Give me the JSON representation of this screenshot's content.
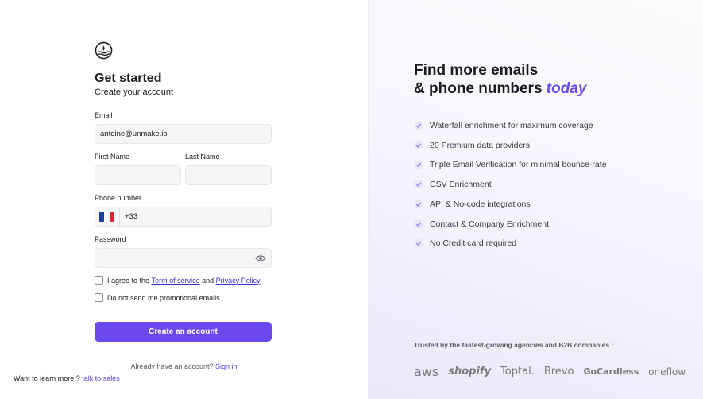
{
  "signup": {
    "title": "Get started",
    "subtitle": "Create your account",
    "email_label": "Email",
    "email_value": "antoine@unmake.io",
    "first_name_label": "First Name",
    "last_name_label": "Last Name",
    "phone_label": "Phone number",
    "phone_prefix": "+33",
    "password_label": "Password",
    "agree_text": "I agree to the",
    "terms_link": "Term of service",
    "and_text": "and",
    "privacy_link": "Privacy Policy",
    "no_promo_text": "Do not send me promotional emails",
    "create_button": "Create an account",
    "have_account": "Already have an account?",
    "sign_in_link": "Sign in",
    "learn_more": "Want to learn more ?",
    "talk_to_sales": "talk to sales"
  },
  "promo": {
    "title_line1": "Find more emails",
    "title_line2": "& phone numbers",
    "title_emphasis": "today",
    "features": [
      "Waterfall enrichment for maximum coverage",
      "20 Premium data providers",
      "Triple Email Verification for minimal bounce-rate",
      "CSV Enrichment",
      "API & No-code integrations",
      "Contact & Company Enrichment",
      "No Credit card required"
    ],
    "trusted_text": "Trusted by the fastest-growing agencies and B2B companies :",
    "brands": [
      "aws",
      "shopify",
      "Toptal.",
      "Brevo",
      "GoCardless",
      "oneflow"
    ]
  },
  "colors": {
    "accent": "#6a48ec",
    "link": "#3a2ccf",
    "check": "#8b7fe0",
    "panel_bg": "#f4f2fc"
  },
  "icons": {
    "logo": "sparkle-waves-logo-icon",
    "flag": "france-flag-icon",
    "password_toggle": "eye-icon",
    "feature_check": "check-circle-icon"
  }
}
